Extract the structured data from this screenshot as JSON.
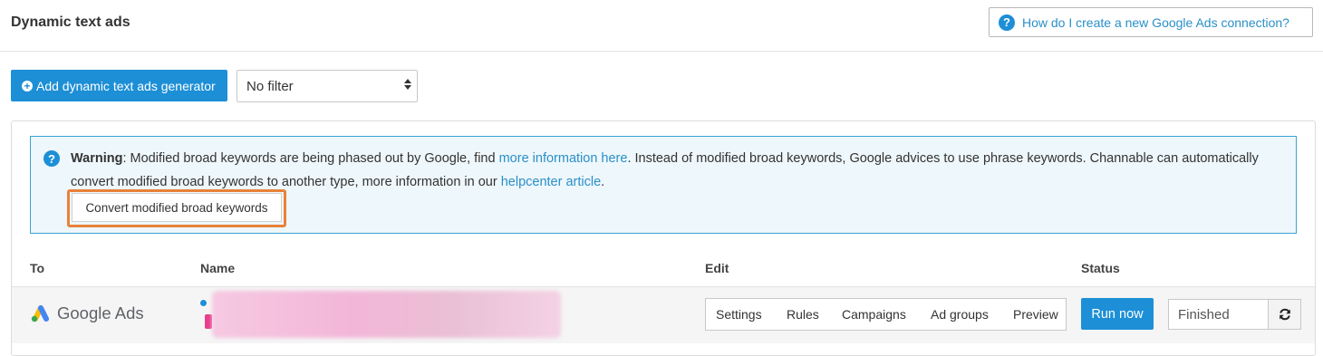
{
  "header": {
    "title": "Dynamic text ads",
    "help_link_label": "How do I create a new Google Ads connection?"
  },
  "toolbar": {
    "add_button_label": "Add dynamic text ads generator",
    "filter_value": "No filter"
  },
  "warning": {
    "prefix": "Warning",
    "text_1": ": Modified broad keywords are being phased out by Google, find ",
    "link_1": "more information here",
    "text_2": ". Instead of modified broad keywords, Google advices to use phrase keywords. Channable can automatically convert modified broad keywords to another type, more information in our ",
    "link_2": "helpcenter article",
    "text_3": ".",
    "button_label": "Convert modified broad keywords"
  },
  "table": {
    "columns": [
      "To",
      "Name",
      "Edit",
      "Status"
    ],
    "rows": [
      {
        "to_logo_text": "Google Ads",
        "edit_actions": [
          "Settings",
          "Rules",
          "Campaigns",
          "Ad groups",
          "Preview"
        ],
        "run_label": "Run now",
        "status": "Finished"
      }
    ]
  },
  "colors": {
    "accent": "#1d8fd6",
    "highlight": "#e8823a",
    "warning_border": "#39a3d4",
    "warning_bg": "#eef7fb"
  },
  "icons": [
    "question-circle-icon",
    "plus-circle-icon",
    "sort-icon",
    "google-ads-logo",
    "refresh-icon"
  ]
}
